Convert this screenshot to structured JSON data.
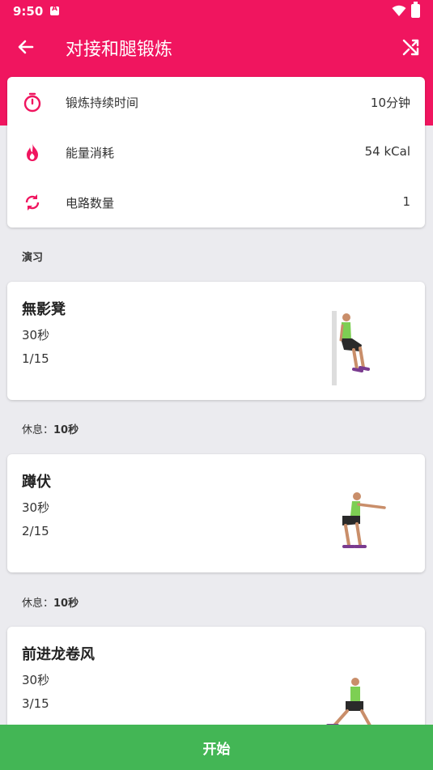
{
  "status_bar": {
    "time": "9:50",
    "notification_letter": "A"
  },
  "app_bar": {
    "title": "对接和腿锻炼",
    "back_icon": "arrow-left-icon",
    "shuffle_icon": "shuffle-icon"
  },
  "colors": {
    "primary": "#f0155f",
    "accent_green": "#43b655",
    "background": "#ebebef"
  },
  "summary": {
    "rows": [
      {
        "icon": "stopwatch-icon",
        "label": "锻炼持续时间",
        "value": "10分钟"
      },
      {
        "icon": "flame-icon",
        "label": "能量消耗",
        "value": "54 kCal"
      },
      {
        "icon": "repeat-icon",
        "label": "电路数量",
        "value": "1"
      }
    ]
  },
  "section_title": "演习",
  "exercises": [
    {
      "name": "無影凳",
      "duration": "30秒",
      "index": "1/15"
    },
    {
      "name": "蹲伏",
      "duration": "30秒",
      "index": "2/15"
    },
    {
      "name": "前进龙卷风",
      "duration": "30秒",
      "index": "3/15"
    }
  ],
  "rests": [
    {
      "label": "休息：",
      "value": "10秒"
    },
    {
      "label": "休息：",
      "value": "10秒"
    }
  ],
  "start_button": {
    "label": "开始"
  }
}
